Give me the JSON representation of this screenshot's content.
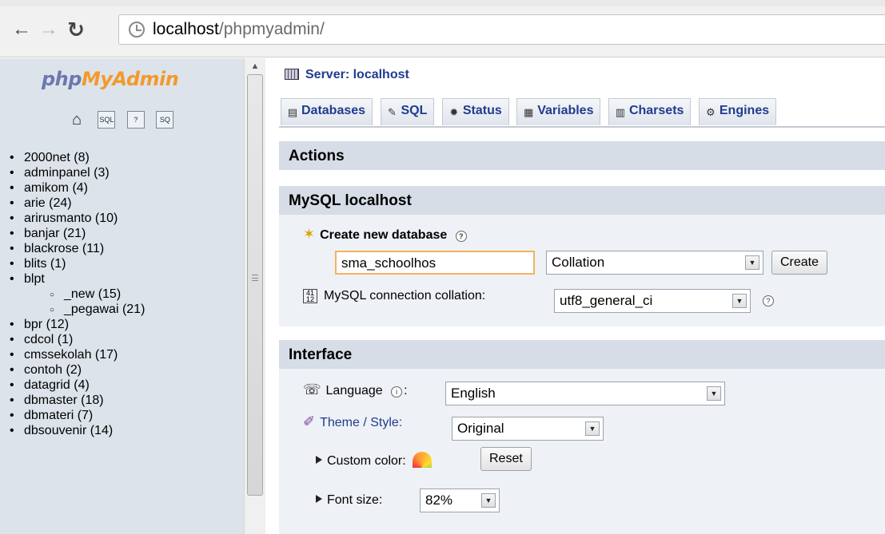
{
  "browser": {
    "url_host": "localhost",
    "url_path": "/phpmyadmin/"
  },
  "sidebar": {
    "logo": {
      "php": "php",
      "my": "My",
      "admin": "Admin"
    },
    "buttons": [
      "home-icon",
      "sql-query-icon",
      "documentation-icon",
      "sql-docs-icon"
    ],
    "databases": [
      {
        "label": "2000net (8)",
        "level": 0
      },
      {
        "label": "adminpanel (3)",
        "level": 0
      },
      {
        "label": "amikom (4)",
        "level": 0
      },
      {
        "label": "arie (24)",
        "level": 0
      },
      {
        "label": "arirusmanto (10)",
        "level": 0
      },
      {
        "label": "banjar (21)",
        "level": 0
      },
      {
        "label": "blackrose (11)",
        "level": 0
      },
      {
        "label": "blits (1)",
        "level": 0
      },
      {
        "label": "blpt",
        "level": 0
      },
      {
        "label": "_new (15)",
        "level": 1
      },
      {
        "label": "_pegawai (21)",
        "level": 1
      },
      {
        "label": "bpr (12)",
        "level": 0
      },
      {
        "label": "cdcol (1)",
        "level": 0
      },
      {
        "label": "cmssekolah (17)",
        "level": 0
      },
      {
        "label": "contoh (2)",
        "level": 0
      },
      {
        "label": "datagrid (4)",
        "level": 0
      },
      {
        "label": "dbmaster (18)",
        "level": 0
      },
      {
        "label": "dbmateri (7)",
        "level": 0
      },
      {
        "label": "dbsouvenir (14)",
        "level": 0
      }
    ]
  },
  "main": {
    "server_label": "Server: localhost",
    "tabs": [
      {
        "label": "Databases",
        "icon": "databases-icon"
      },
      {
        "label": "SQL",
        "icon": "sql-icon"
      },
      {
        "label": "Status",
        "icon": "status-icon"
      },
      {
        "label": "Variables",
        "icon": "variables-icon"
      },
      {
        "label": "Charsets",
        "icon": "charsets-icon"
      },
      {
        "label": "Engines",
        "icon": "engines-icon"
      }
    ],
    "actions_title": "Actions",
    "mysql": {
      "title": "MySQL localhost",
      "create_db_label": "Create new database",
      "create_db_value": "sma_schoolhos",
      "collation_placeholder": "Collation",
      "create_button": "Create",
      "connection_collation_label": "MySQL connection collation:",
      "connection_collation_value": "utf8_general_ci"
    },
    "interface": {
      "title": "Interface",
      "language_label": "Language",
      "language_value": "English",
      "theme_label": "Theme / Style:",
      "theme_value": "Original",
      "custom_color_label": "Custom color:",
      "reset_button": "Reset",
      "font_size_label": "Font size:",
      "font_size_value": "82%"
    }
  }
}
